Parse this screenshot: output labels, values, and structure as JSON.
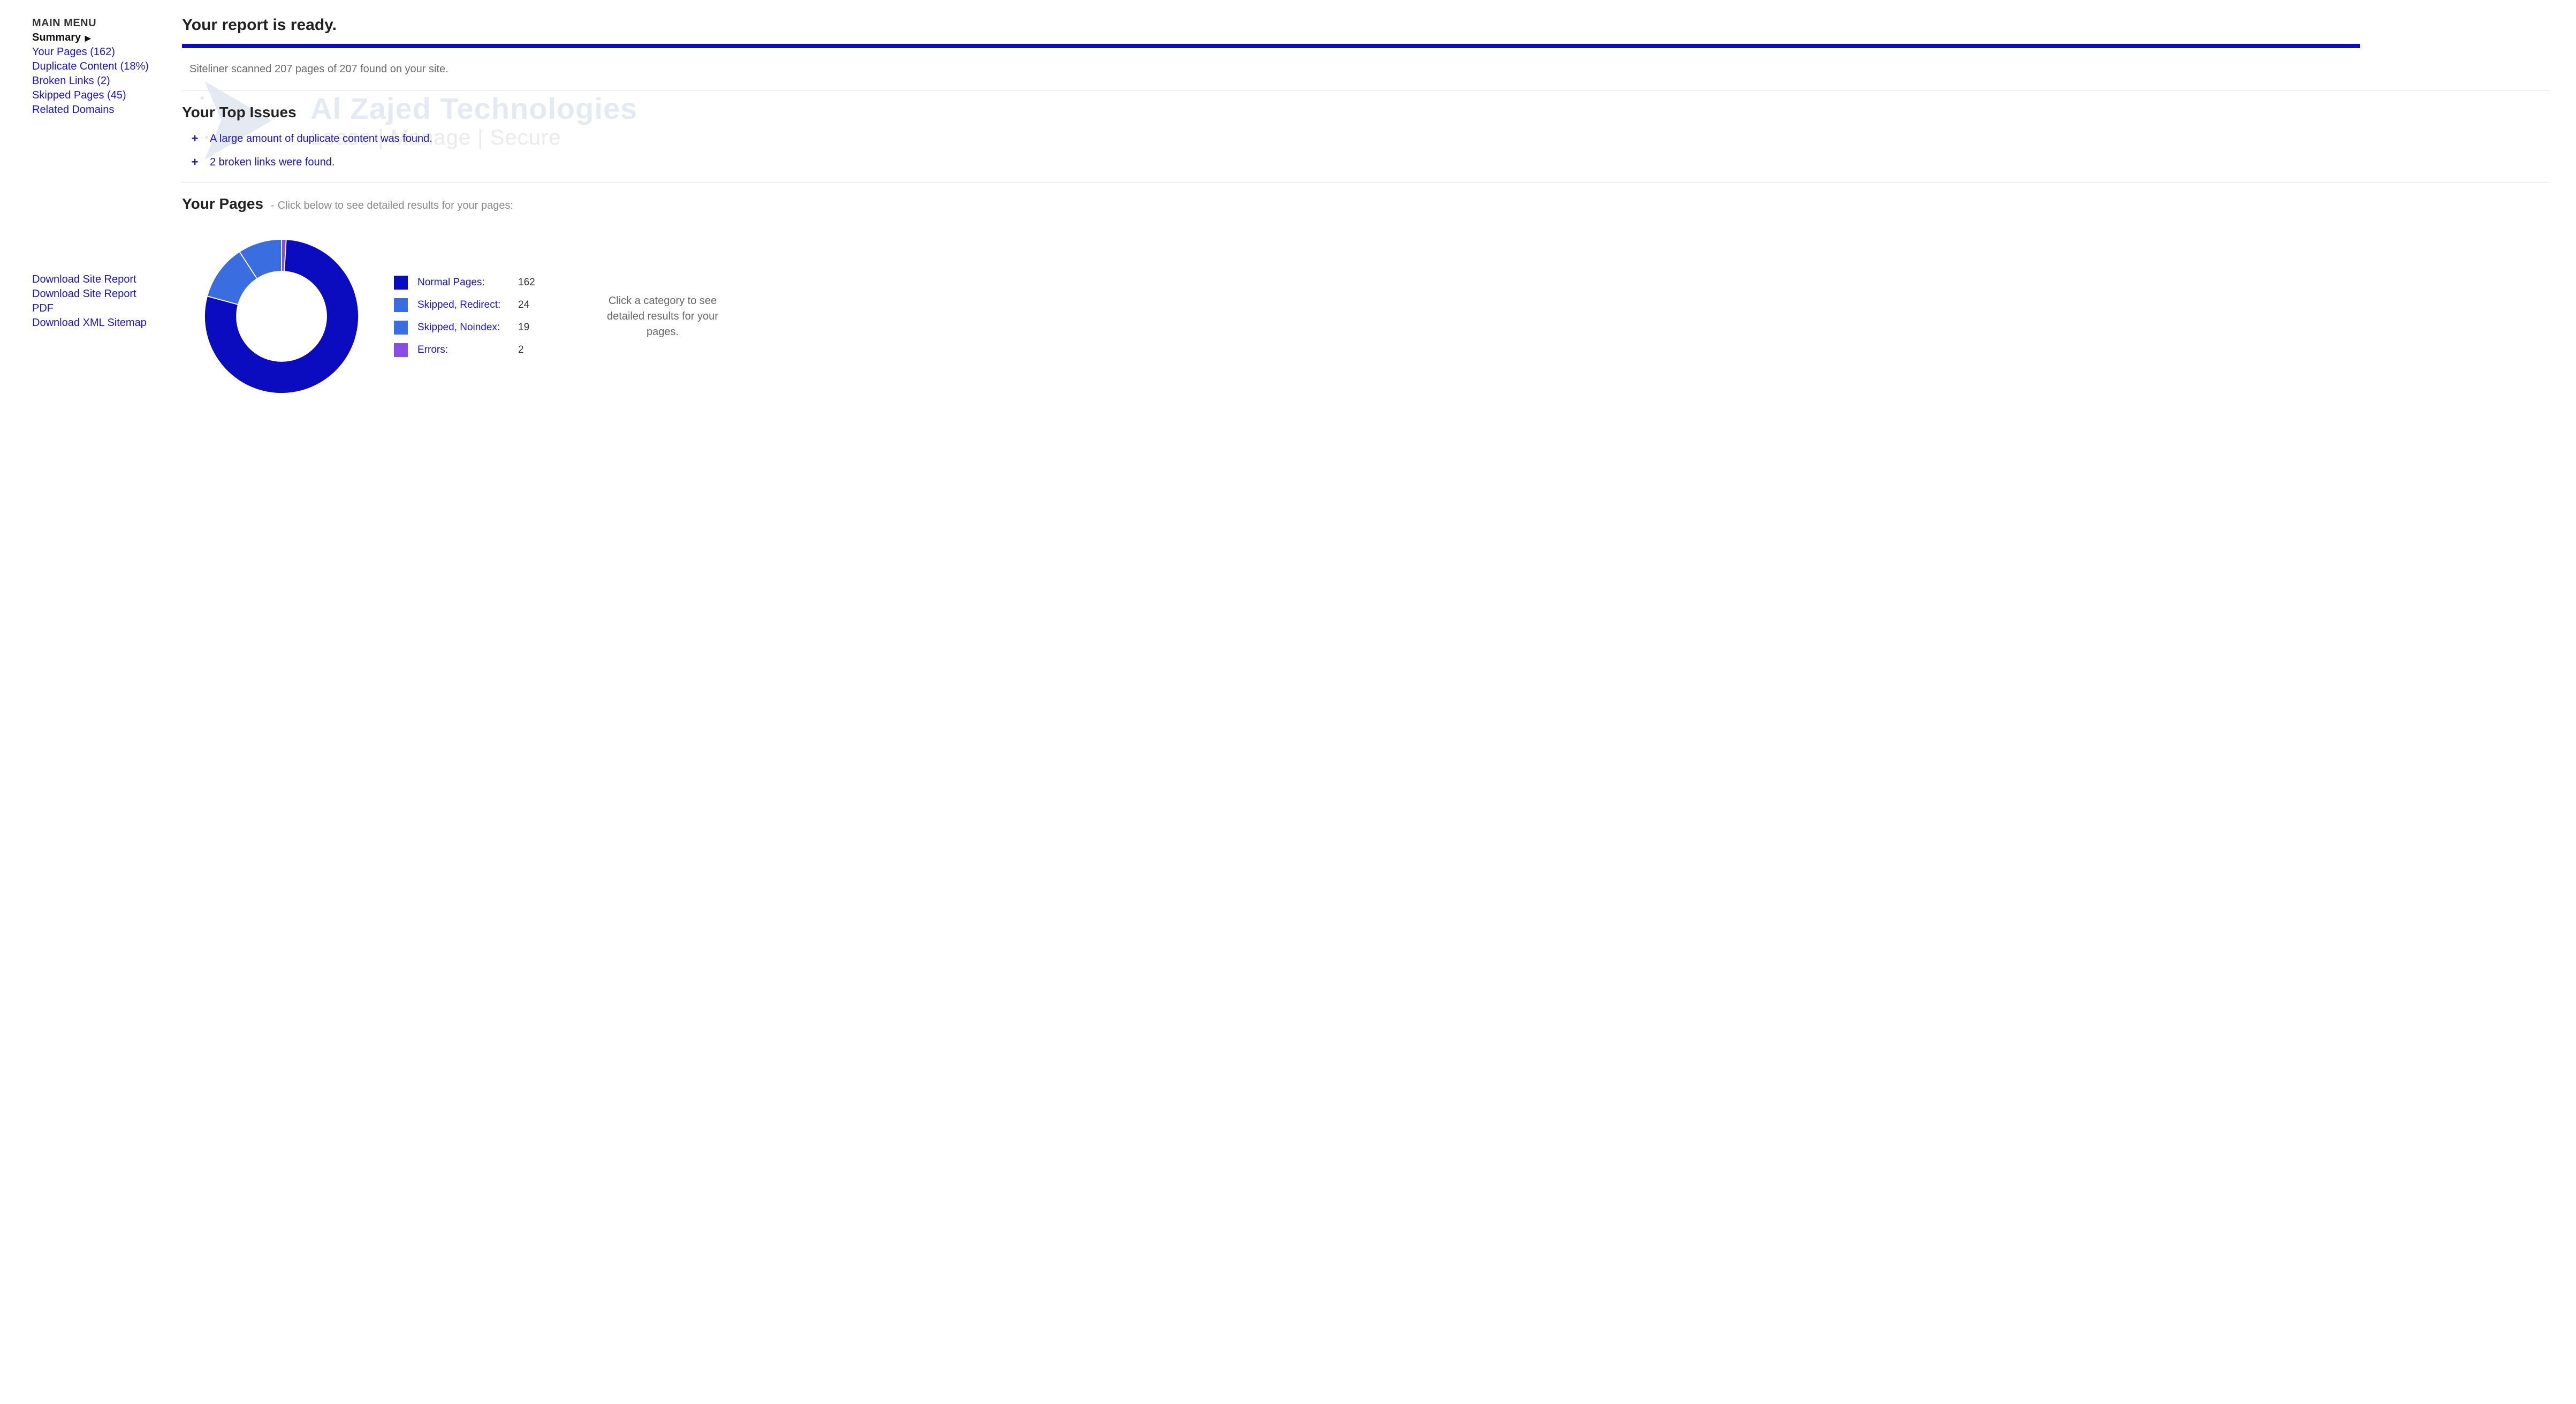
{
  "sidebar": {
    "menu_title": "MAIN MENU",
    "active": "Summary",
    "items": [
      "Your Pages (162)",
      "Duplicate Content (18%)",
      "Broken Links (2)",
      "Skipped Pages (45)",
      "Related Domains"
    ],
    "downloads": [
      "Download Site Report",
      "Download Site Report PDF",
      "Download XML Sitemap"
    ]
  },
  "report": {
    "title": "Your report is ready.",
    "scan_line": "Siteliner scanned 207 pages of 207 found on your site.",
    "top_issues_heading": "Your Top Issues",
    "issues": [
      "A large amount of duplicate content was found.",
      "2 broken links were found."
    ],
    "pages_heading": "Your Pages",
    "pages_sub": "Click below to see detailed results for your pages:",
    "hint": "Click a category to see detailed results for your pages."
  },
  "chart_data": {
    "type": "pie",
    "title": "Your Pages",
    "series": [
      {
        "name": "Normal Pages:",
        "value": 162,
        "color": "#0b0bbf"
      },
      {
        "name": "Skipped, Redirect:",
        "value": 24,
        "color": "#3a6de0"
      },
      {
        "name": "Skipped, Noindex:",
        "value": 19,
        "color": "#3a6de0"
      },
      {
        "name": "Errors:",
        "value": 2,
        "color": "#8a4be8"
      }
    ]
  },
  "watermark": {
    "name": "Al Zajed Technologies",
    "tag": "Lease | Manage | Secure"
  }
}
